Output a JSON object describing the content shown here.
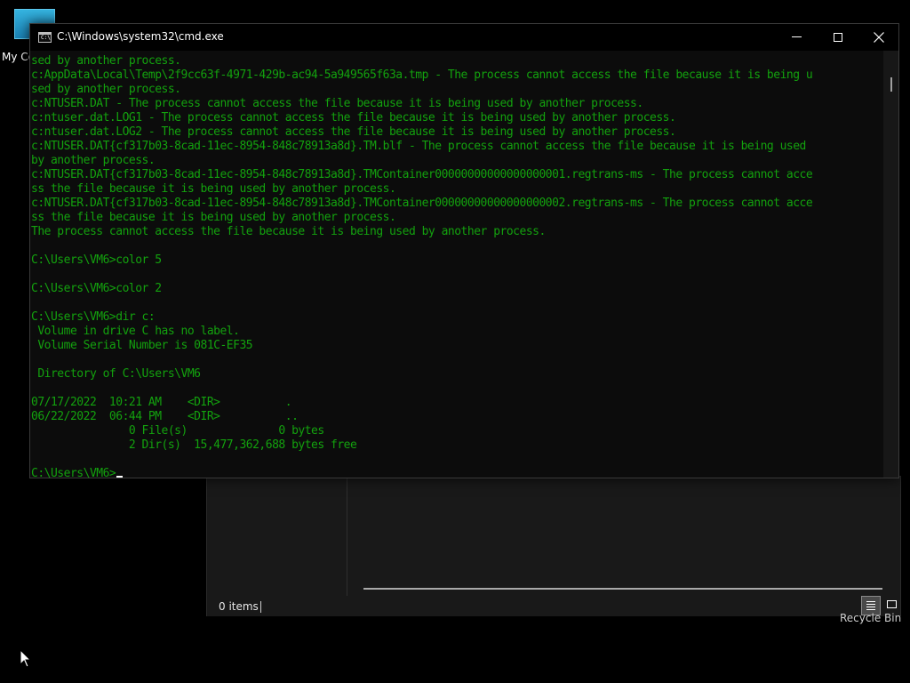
{
  "desktop": {
    "my_computer_label": "My Co",
    "recycle_bin_label": "Recycle Bin"
  },
  "explorer": {
    "status_text": "0 items",
    "view_details_icon": "details-view-icon",
    "view_tiles_icon": "large-icons-view-icon"
  },
  "cmd": {
    "title": "C:\\Windows\\system32\\cmd.exe",
    "text_color": "#13a10e",
    "background_color": "#0c0c0c",
    "titlebar_buttons": [
      "minimize-icon",
      "maximize-icon",
      "close-icon"
    ],
    "lines": [
      "sed by another process.",
      "c:AppData\\Local\\Temp\\2f9cc63f-4971-429b-ac94-5a949565f63a.tmp - The process cannot access the file because it is being u",
      "sed by another process.",
      "c:NTUSER.DAT - The process cannot access the file because it is being used by another process.",
      "c:ntuser.dat.LOG1 - The process cannot access the file because it is being used by another process.",
      "c:ntuser.dat.LOG2 - The process cannot access the file because it is being used by another process.",
      "c:NTUSER.DAT{cf317b03-8cad-11ec-8954-848c78913a8d}.TM.blf - The process cannot access the file because it is being used",
      "by another process.",
      "c:NTUSER.DAT{cf317b03-8cad-11ec-8954-848c78913a8d}.TMContainer00000000000000000001.regtrans-ms - The process cannot acce",
      "ss the file because it is being used by another process.",
      "c:NTUSER.DAT{cf317b03-8cad-11ec-8954-848c78913a8d}.TMContainer00000000000000000002.regtrans-ms - The process cannot acce",
      "ss the file because it is being used by another process.",
      "The process cannot access the file because it is being used by another process.",
      "",
      "C:\\Users\\VM6>color 5",
      "",
      "C:\\Users\\VM6>color 2",
      "",
      "C:\\Users\\VM6>dir c:",
      " Volume in drive C has no label.",
      " Volume Serial Number is 081C-EF35",
      "",
      " Directory of C:\\Users\\VM6",
      "",
      "07/17/2022  10:21 AM    <DIR>          .",
      "06/22/2022  06:44 PM    <DIR>          ..",
      "               0 File(s)              0 bytes",
      "               2 Dir(s)  15,477,362,688 bytes free",
      "",
      "C:\\Users\\VM6>"
    ]
  }
}
